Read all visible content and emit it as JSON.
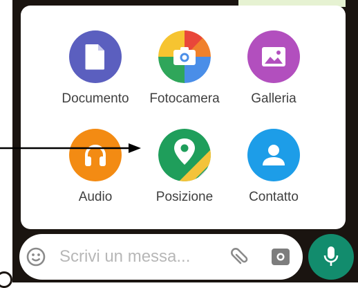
{
  "attach_menu": {
    "items": [
      {
        "key": "documento",
        "label": "Documento",
        "icon": "document-icon",
        "color": "#5b5fbf"
      },
      {
        "key": "fotocamera",
        "label": "Fotocamera",
        "icon": "camera-icon",
        "color": "#e9473a"
      },
      {
        "key": "galleria",
        "label": "Galleria",
        "icon": "gallery-icon",
        "color": "#b24fbe"
      },
      {
        "key": "audio",
        "label": "Audio",
        "icon": "headphones-icon",
        "color": "#f38b13"
      },
      {
        "key": "posizione",
        "label": "Posizione",
        "icon": "location-pin-icon",
        "color": "#1f9e5b"
      },
      {
        "key": "contatto",
        "label": "Contatto",
        "icon": "contact-person-icon",
        "color": "#1d9de8"
      }
    ]
  },
  "composer": {
    "placeholder": "Scrivi un messa..."
  },
  "colors": {
    "background_dark": "#1a1410",
    "panel": "#ffffff",
    "mic_button": "#128c6d"
  }
}
